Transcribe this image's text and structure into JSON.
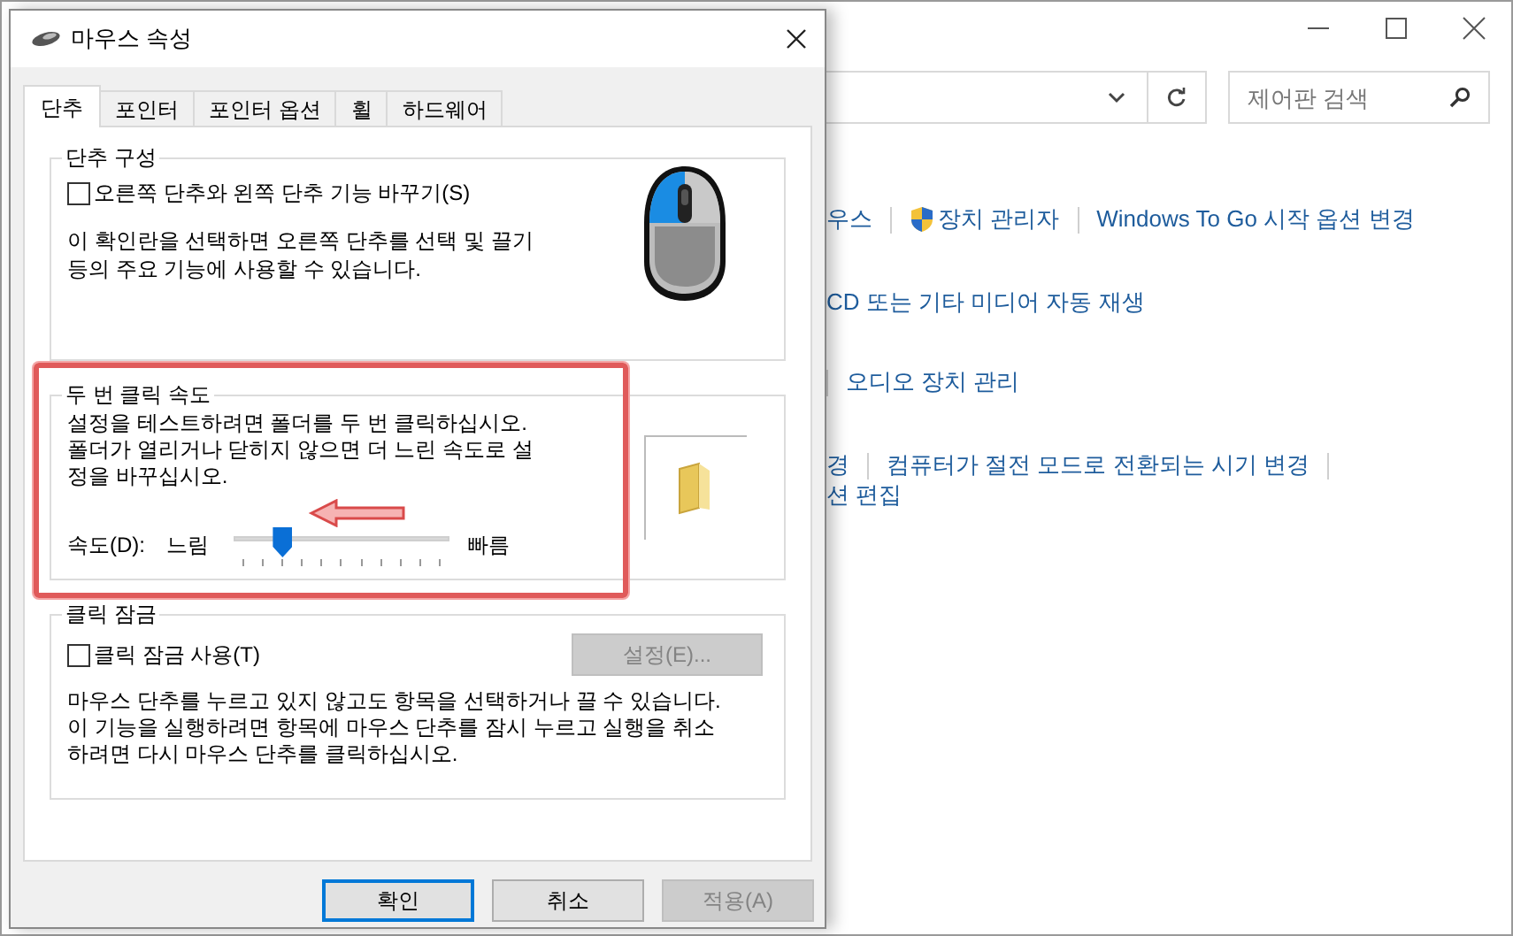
{
  "background_window": {
    "search": {
      "placeholder": "제어판 검색"
    },
    "link_rows": [
      {
        "items": [
          {
            "kind": "link",
            "text": "우스"
          },
          {
            "kind": "separator"
          },
          {
            "kind": "link",
            "text": "장치 관리자",
            "shield": true
          },
          {
            "kind": "separator"
          },
          {
            "kind": "link",
            "text": "Windows To Go 시작 옵션 변경"
          }
        ]
      },
      {
        "items": [
          {
            "kind": "link",
            "text": "CD 또는 기타 미디어 자동 재생"
          }
        ]
      },
      {
        "items": [
          {
            "kind": "separator"
          },
          {
            "kind": "link",
            "text": "오디오 장치 관리"
          }
        ]
      },
      {
        "items": [
          {
            "kind": "link",
            "text": "경"
          },
          {
            "kind": "separator"
          },
          {
            "kind": "link",
            "text": "컴퓨터가 절전 모드로 전환되는 시기 변경"
          },
          {
            "kind": "separator"
          }
        ]
      },
      {
        "items": [
          {
            "kind": "link",
            "text": "션 편집"
          }
        ]
      }
    ]
  },
  "dialog": {
    "title": "마우스 속성",
    "tabs": [
      {
        "label": "단추",
        "selected": true
      },
      {
        "label": "포인터",
        "selected": false
      },
      {
        "label": "포인터 옵션",
        "selected": false
      },
      {
        "label": "휠",
        "selected": false
      },
      {
        "label": "하드웨어",
        "selected": false
      }
    ],
    "button_config": {
      "title": "단추 구성",
      "checkbox": {
        "label": "오른쪽 단추와 왼쪽 단추 기능 바꾸기(S)",
        "checked": false
      },
      "description": "이 확인란을 선택하면 오른쪽 단추를 선택 및 끌기\n등의 주요 기능에 사용할 수 있습니다."
    },
    "double_click": {
      "title": "두 번 클릭 속도",
      "description": "설정을 테스트하려면 폴더를 두 번 클릭하십시오.\n폴더가 열리거나 닫히지 않으면 더 느린 속도로 설\n정을 바꾸십시오.",
      "speed_label": "속도(D):",
      "slow_label": "느림",
      "fast_label": "빠름",
      "level": 0.2
    },
    "click_lock": {
      "title": "클릭 잠금",
      "checkbox": {
        "label": "클릭 잠금 사용(T)",
        "checked": false
      },
      "settings_button": {
        "label": "설정(E)...",
        "disabled": true
      },
      "description": "마우스 단추를 누르고 있지 않고도 항목을 선택하거나 끌 수 있습니다.\n이 기능을 실행하려면 항목에 마우스 단추를 잠시 누르고 실행을 취소\n하려면 다시 마우스 단추를 클릭하십시오."
    },
    "buttons": [
      {
        "label": "확인",
        "disabled": false,
        "default": true
      },
      {
        "label": "취소",
        "disabled": false,
        "default": false
      },
      {
        "label": "적용(A)",
        "disabled": true,
        "default": false
      }
    ]
  }
}
